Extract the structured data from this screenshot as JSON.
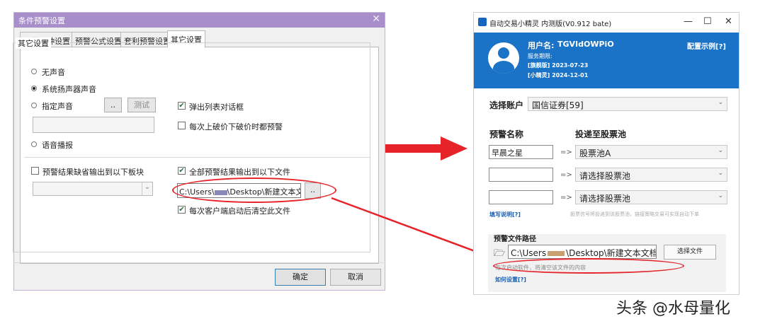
{
  "dialog": {
    "title": "条件预警设置",
    "tabs": [
      "预警品种设置",
      "预警公式设置",
      "套利预警设置",
      "其它设置"
    ],
    "group_title": "其它设置",
    "radios": {
      "none": "无声音",
      "system": "系统扬声器声音",
      "custom": "指定声音",
      "voice": "语音播报"
    },
    "browse_btn": "..",
    "test_btn": "测试",
    "chk_popup": "弹出列表对话框",
    "chk_each_break": "每次上破价下破价时都预警",
    "chk_default_output": "预警结果缺省输出到以下板块",
    "chk_output_file": "全部预警结果输出到以下文件",
    "file_path": "C:\\Users\\",
    "file_path_tail": "\\Desktop\\新建文本文",
    "chk_clear_file": "每次客户端启动后清空此文件",
    "ok": "确定",
    "cancel": "取消",
    "close": "✕",
    "check_mark": "✔",
    "combo_arrow": "⌄"
  },
  "app": {
    "title": "自动交易小精灵 内测版(V0.912 bate)",
    "minimize": "—",
    "maximize": "☐",
    "close": "✕",
    "user_label": "用户名:",
    "username": "TGVIdOWPiO",
    "service_label": "服务期限:",
    "flagship": "[旗舰版] 2023-07-23",
    "sprite": "[小精灵] 2024-12-01",
    "config_example": "配置示例[?]",
    "account_label": "选择账户",
    "account_value": "国信证券[59]",
    "alert_name_label": "预警名称",
    "pool_label": "投递至股票池",
    "arrow_symbol": "=>",
    "rows": [
      {
        "name": "早晨之星",
        "pool": "股票池A"
      },
      {
        "name": "",
        "pool": "请选择股票池"
      },
      {
        "name": "",
        "pool": "请选择股票池"
      }
    ],
    "help_link": "填写说明[?]",
    "help_desc": "股票信号将投递到该股票池，链接策略交易可实现自动下单",
    "file_path_label": "预警文件路径",
    "file_path": "C:\\Users",
    "file_path_tail": "\\Desktop\\新建文本文档.tx",
    "choose_file": "选择文件",
    "clear_note": "每次启动软件，将清空该文件的内容",
    "how_to": "如何设置[?]",
    "folder_icon": "🗁",
    "combo_arrow": "⌄"
  },
  "watermark": "头条 @水母量化",
  "colors": {
    "annotation": "#e62329",
    "banner": "#1a73c6",
    "dialog_title": "#a88fc9"
  }
}
